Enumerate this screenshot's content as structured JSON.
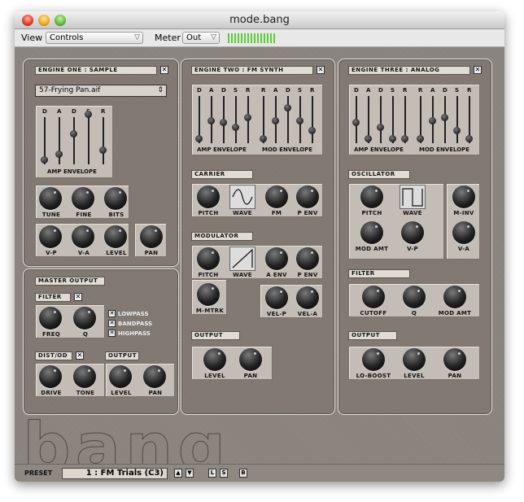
{
  "window": {
    "title": "mode.bang"
  },
  "toolbar": {
    "view_label": "View",
    "view_value": "Controls",
    "meter_label": "Meter",
    "meter_value": "Out"
  },
  "engine1": {
    "title": "ENGINE ONE : SAMPLE",
    "file": "57-Frying Pan.aif",
    "adsr_letters": [
      "D",
      "A",
      "D",
      "S",
      "R"
    ],
    "env_label": "AMP ENVELOPE",
    "knobs_row1": [
      "TUNE",
      "FINE",
      "BITS"
    ],
    "knobs_row2": [
      "V-P",
      "V-A",
      "LEVEL",
      "PAN"
    ]
  },
  "engine2": {
    "title": "ENGINE TWO : FM SYNTH",
    "adsr_letters": [
      "D",
      "A",
      "D",
      "S",
      "R",
      "R",
      "A",
      "D",
      "S",
      "R"
    ],
    "amp_env": "AMP ENVELOPE",
    "mod_env": "MOD ENVELOPE",
    "carrier": {
      "title": "CARRIER",
      "knobs": [
        "PITCH",
        "WAVE",
        "FM",
        "P ENV"
      ]
    },
    "modulator": {
      "title": "MODULATOR",
      "knobs": [
        "PITCH",
        "WAVE",
        "A ENV",
        "P ENV"
      ],
      "mmtrk": "M-MTRK",
      "vel": [
        "VEL-P",
        "VEL-A"
      ]
    },
    "output": {
      "title": "OUTPUT",
      "knobs": [
        "LEVEL",
        "PAN"
      ]
    }
  },
  "engine3": {
    "title": "ENGINE THREE : ANALOG",
    "adsr_letters": [
      "D",
      "A",
      "D",
      "S",
      "R",
      "R",
      "A",
      "D",
      "S",
      "R"
    ],
    "amp_env": "AMP ENVELOPE",
    "mod_env": "MOD ENVELOPE",
    "oscillator": {
      "title": "OSCILLATOR",
      "knobs": [
        "PITCH",
        "WAVE",
        "M-INV",
        "MOD AMT",
        "V-P",
        "V-A"
      ]
    },
    "filter": {
      "title": "FILTER",
      "knobs": [
        "CUTOFF",
        "Q",
        "MOD AMT"
      ]
    },
    "output": {
      "title": "OUTPUT",
      "knobs": [
        "LO-BOOST",
        "LEVEL",
        "PAN"
      ]
    }
  },
  "master": {
    "title": "MASTER OUTPUT",
    "filter_title": "FILTER",
    "filter_knobs": [
      "FREQ",
      "Q"
    ],
    "modes": [
      "LOWPASS",
      "BANDPASS",
      "HIGHPASS"
    ],
    "dist_title": "DIST/OD",
    "dist_knobs": [
      "DRIVE",
      "TONE"
    ],
    "output_title": "OUTPUT",
    "output_knobs": [
      "LEVEL",
      "PAN"
    ]
  },
  "close_glyph": "✕",
  "bottom": {
    "preset_label": "PRESET",
    "preset_value": "1 : FM Trials (C3)",
    "up": "▲",
    "down": "▼",
    "l": "L",
    "s": "S",
    "b": "B"
  },
  "decor_text": "bang"
}
